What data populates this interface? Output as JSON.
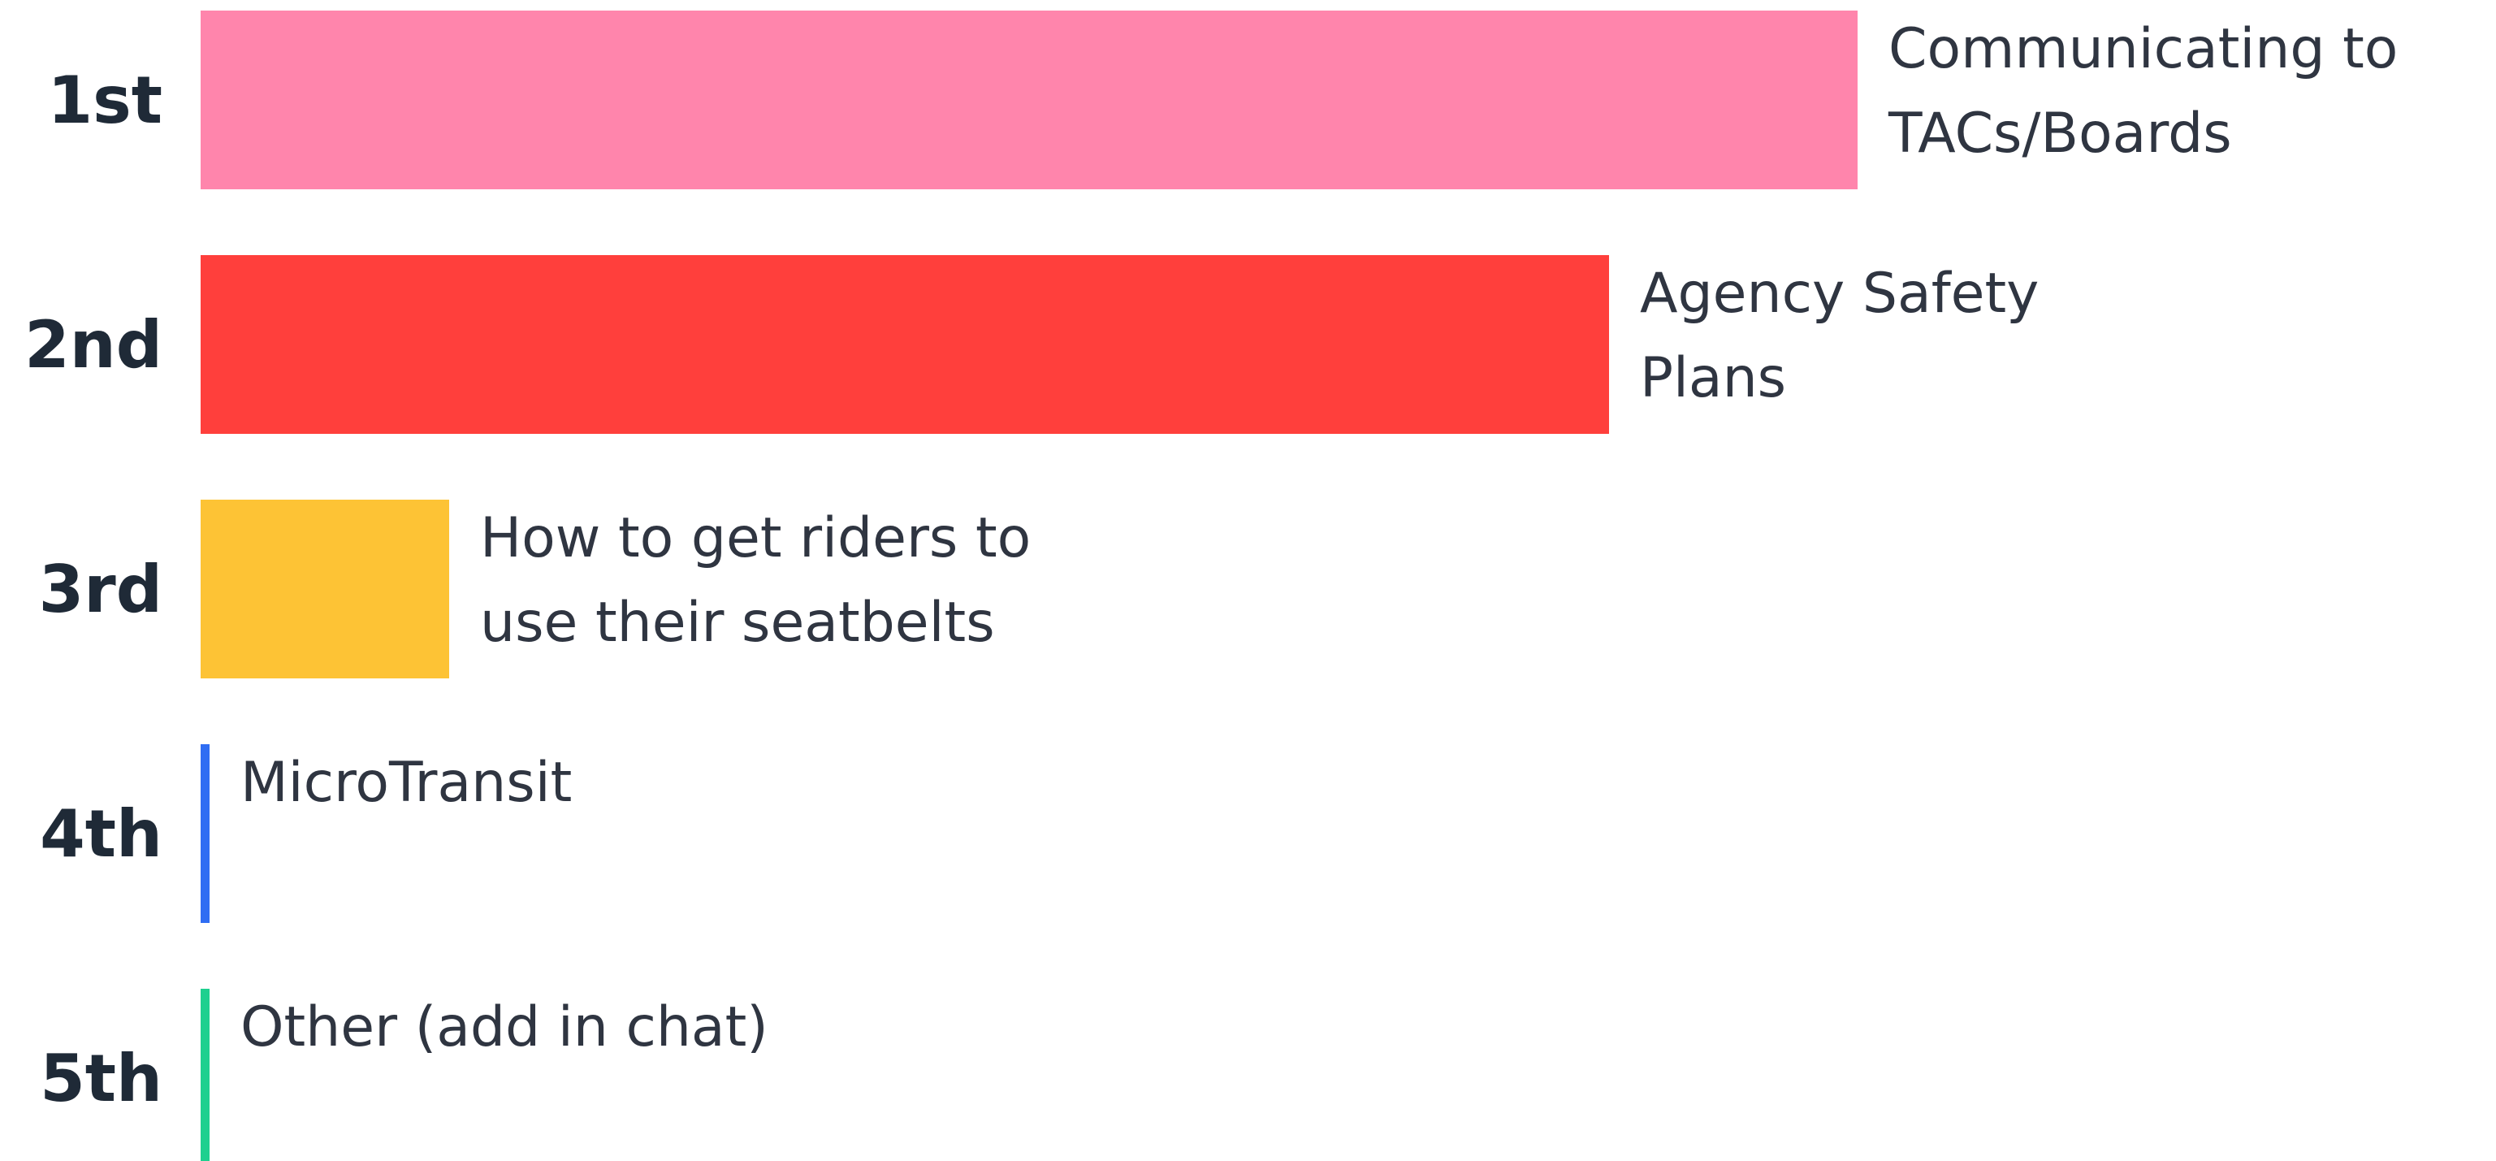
{
  "chart_data": {
    "type": "bar",
    "orientation": "horizontal",
    "categories": [
      "1st",
      "2nd",
      "3rd",
      "4th",
      "5th"
    ],
    "series": [
      {
        "labels": [
          [
            "Communicating to",
            "TACs/Boards"
          ],
          [
            "Agency Safety",
            "Plans"
          ],
          [
            "How to get riders to",
            "use their seatbelts"
          ],
          [
            "MicroTransit"
          ],
          [
            "Other (add in chat)"
          ]
        ],
        "values": [
          100,
          85,
          15,
          0,
          0
        ],
        "colors": [
          "#ff85ac",
          "#ff3f3c",
          "#fdc335",
          "#2f6df3",
          "#1ed08f"
        ]
      }
    ],
    "xlim": [
      0,
      100
    ],
    "grid": false,
    "legend": "none"
  }
}
